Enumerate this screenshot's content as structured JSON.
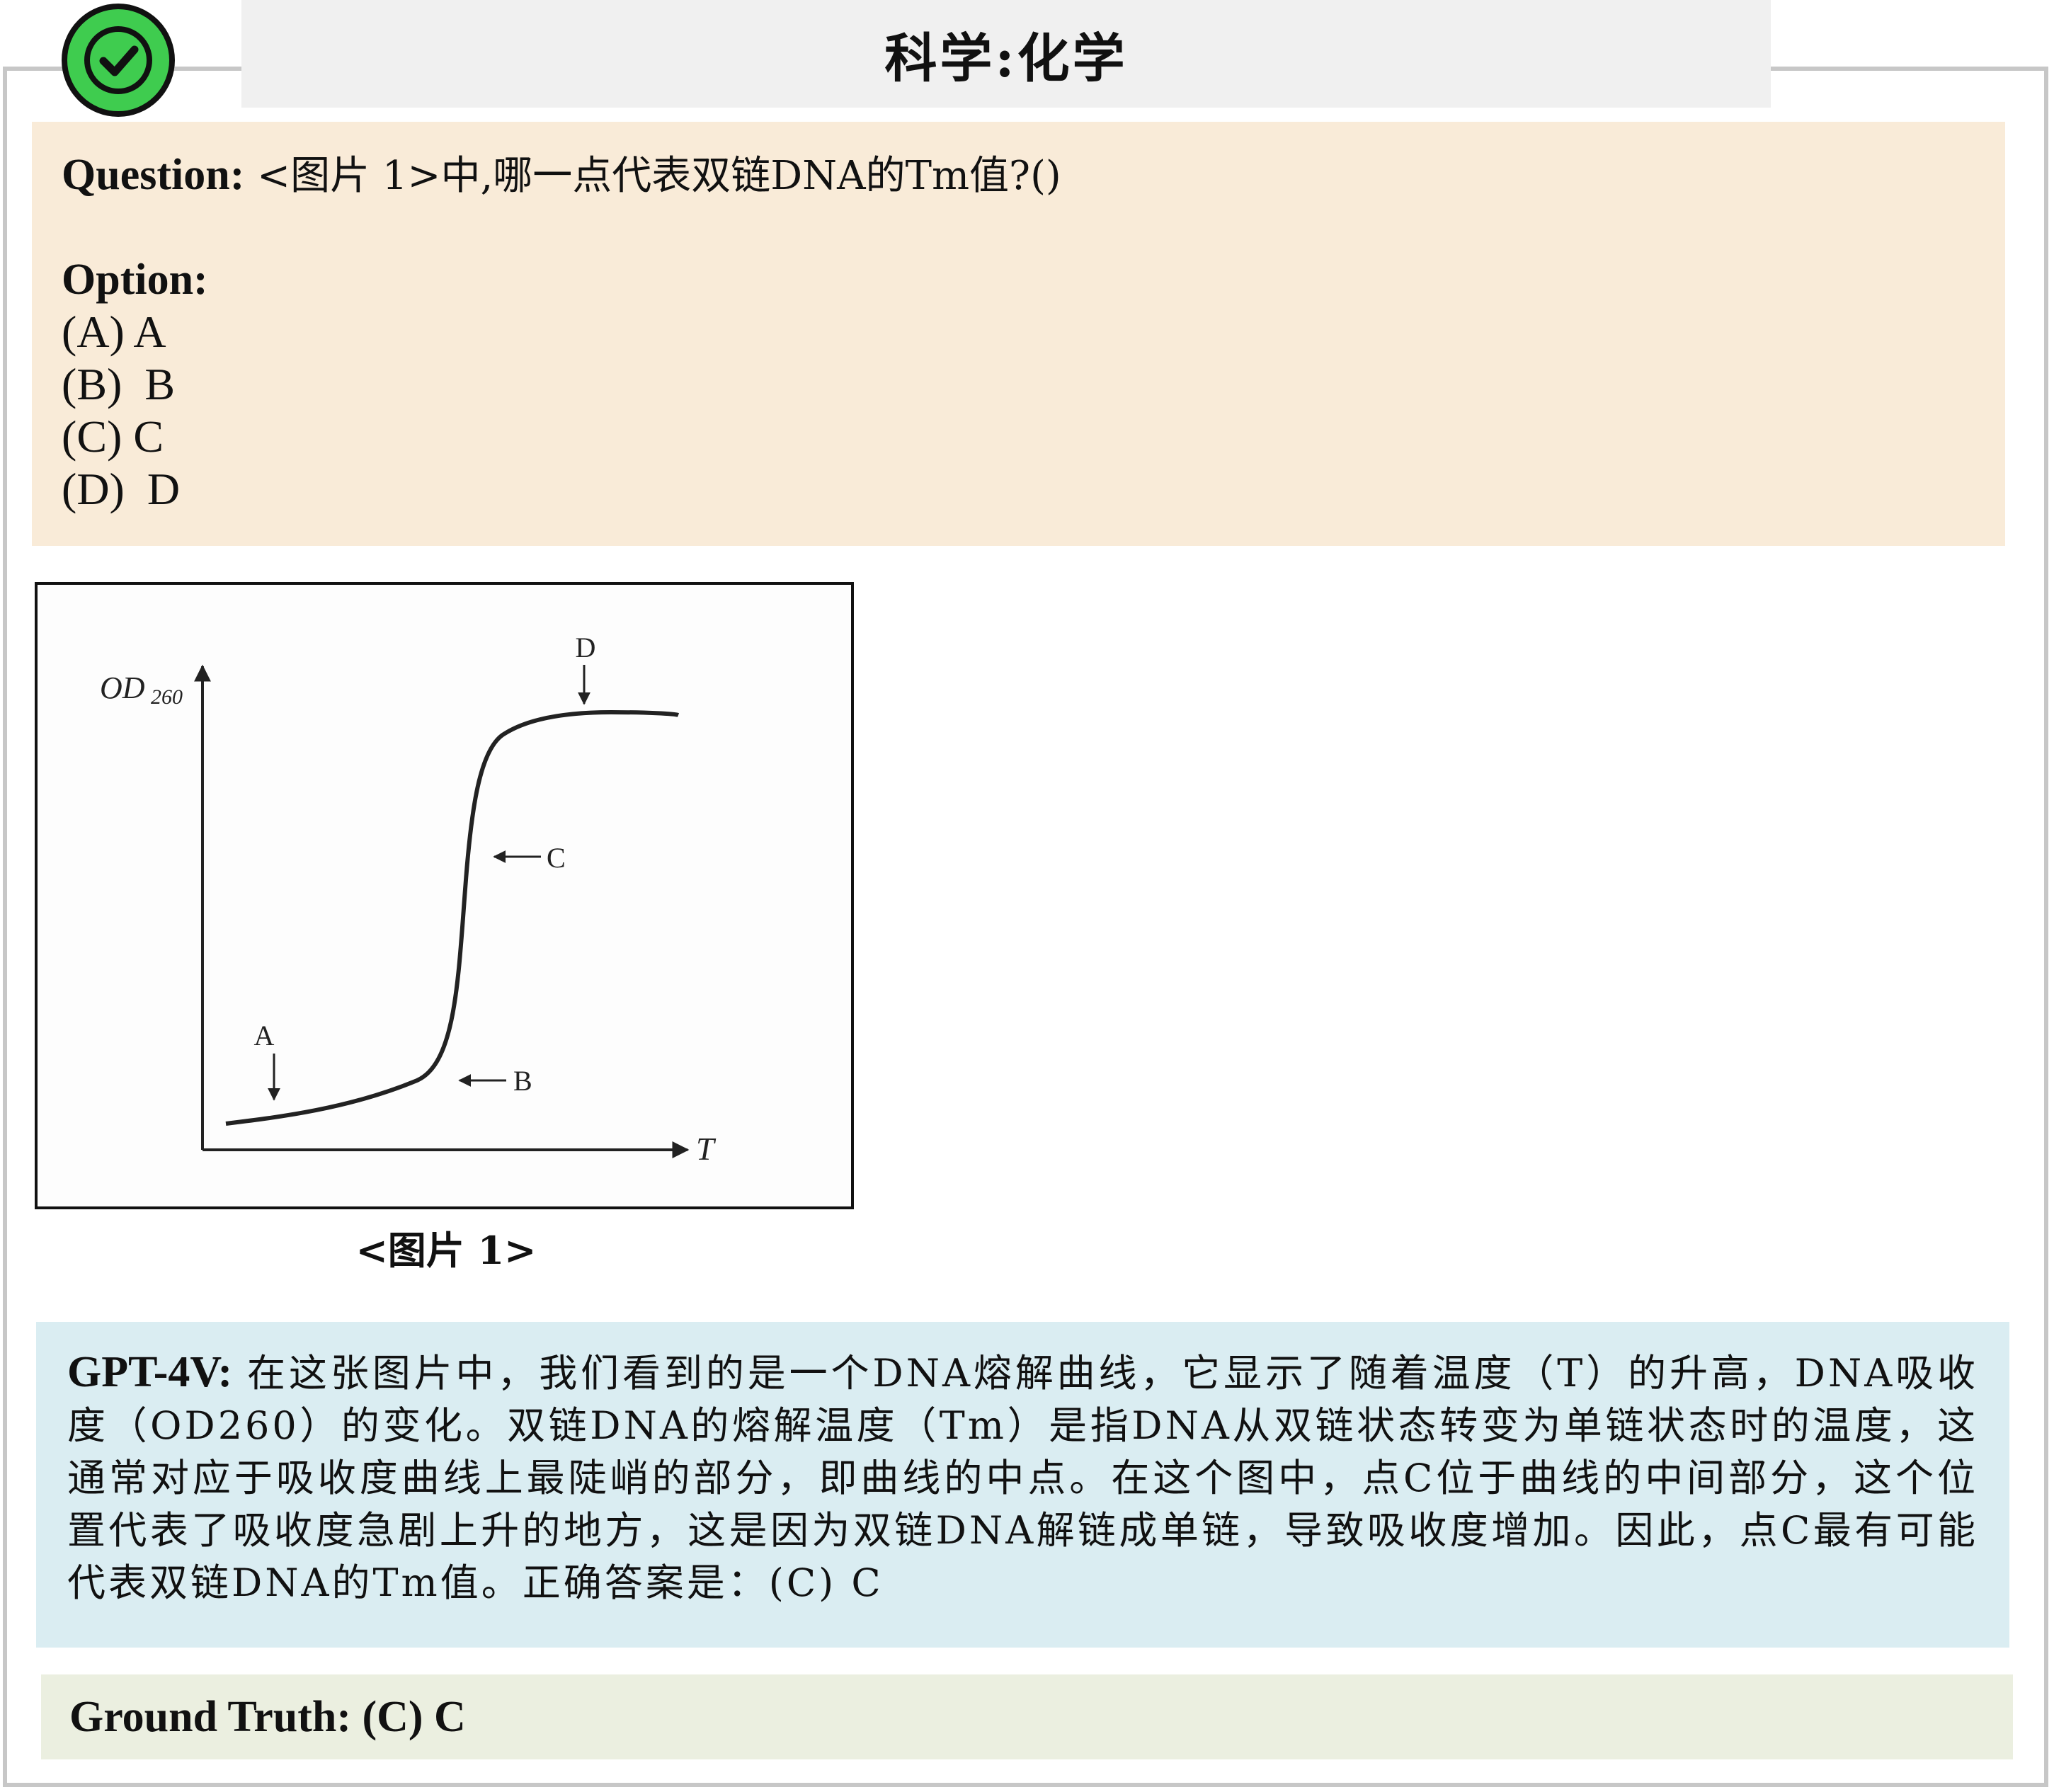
{
  "header": {
    "title": "科学:化学",
    "status_icon": "check-circle-icon",
    "status_color": "#3fcc4f"
  },
  "question": {
    "label": "Question:",
    "text": "<图片 1>中,哪一点代表双链DNA的Tm值?()",
    "option_label": "Option:",
    "options": [
      "(A) A",
      "(B)  B",
      "(C) C",
      "(D)  D"
    ]
  },
  "figure": {
    "caption": "<图片 1>",
    "y_axis_label": "OD",
    "y_axis_subscript": "260",
    "x_axis_label": "T",
    "point_labels": [
      "A",
      "B",
      "C",
      "D"
    ]
  },
  "answer": {
    "label": "GPT-4V:",
    "text": "在这张图片中，我们看到的是一个DNA熔解曲线，它显示了随着温度（T）的升高，DNA吸收度（OD260）的变化。双链DNA的熔解温度（Tm）是指DNA从双链状态转变为单链状态时的温度，这通常对应于吸收度曲线上最陡峭的部分，即曲线的中点。在这个图中，点C位于曲线的中间部分，这个位置代表了吸收度急剧上升的地方，这是因为双链DNA解链成单链，导致吸收度增加。因此，点C最有可能代表双链DNA的Tm值。正确答案是：(C) C"
  },
  "ground_truth": {
    "text": "Ground Truth: (C) C"
  },
  "colors": {
    "question_bg": "#f9ebd8",
    "answer_bg": "#daedf2",
    "truth_bg": "#ebefe0",
    "title_bg": "#f0f0f0"
  }
}
